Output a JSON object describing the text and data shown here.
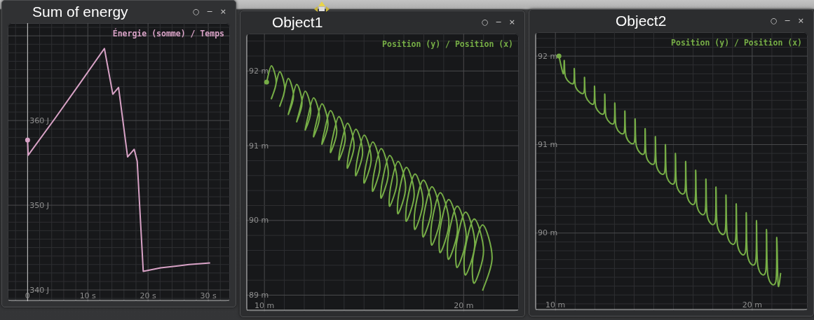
{
  "windows": [
    {
      "title": "Sum of energy",
      "controls": [
        "○",
        "−",
        "×"
      ],
      "chart_data": {
        "type": "line",
        "title": "Énergie (somme) / Temps",
        "grid": true,
        "xlim": [
          -3.3,
          33.6
        ],
        "ylim": [
          338.6,
          371.5
        ],
        "xticks": [
          {
            "value": 0,
            "label": "0"
          },
          {
            "value": 10,
            "label": "10 s"
          },
          {
            "value": 20,
            "label": "20 s"
          },
          {
            "value": 30,
            "label": "30 s"
          }
        ],
        "yticks": [
          {
            "value": 340,
            "label": "340 J"
          },
          {
            "value": 350,
            "label": "350 J"
          },
          {
            "value": 360,
            "label": "360 J"
          }
        ],
        "x": [
          0,
          0.1,
          4.6,
          8.7,
          12.75,
          14.15,
          15.1,
          16.6,
          17.7,
          18.2,
          19.2,
          22.1,
          26.8,
          30.3
        ],
        "series": [
          {
            "color": "#d8a2c6",
            "values": [
              357.7,
              355.9,
              360.3,
              364.4,
              368.5,
              363.1,
              363.9,
              355.7,
              356.6,
              355.2,
              342.2,
              342.6,
              343.0,
              343.2
            ]
          }
        ]
      }
    },
    {
      "title": "Object1",
      "controls": [
        "○",
        "−",
        "×"
      ],
      "chart_data": {
        "type": "line",
        "title": "Position (y) / Position (x)",
        "grid": true,
        "xlim": [
          9.08,
          22.77
        ],
        "ylim": [
          88.78,
          92.5
        ],
        "xticks": [
          {
            "value": 10,
            "label": "10 m"
          },
          {
            "value": 20,
            "label": "20 m"
          }
        ],
        "yticks": [
          {
            "value": 89,
            "label": "89 m"
          },
          {
            "value": 90,
            "label": "90 m"
          },
          {
            "value": 91,
            "label": "91 m"
          },
          {
            "value": 92,
            "label": "92 m"
          }
        ],
        "x": [
          10.11,
          10.35,
          10.59,
          10.35,
          10.52,
          10.77,
          11.02,
          10.77,
          10.94,
          11.2,
          11.46,
          11.2,
          11.35,
          11.62,
          11.89,
          11.62,
          11.77,
          12.05,
          12.33,
          12.05,
          12.18,
          12.47,
          12.76,
          12.47,
          12.59,
          12.89,
          13.19,
          12.89,
          13.01,
          13.32,
          13.63,
          13.32,
          13.42,
          13.74,
          14.06,
          13.74,
          13.84,
          14.17,
          14.5,
          14.17,
          14.25,
          14.59,
          14.93,
          14.59,
          14.66,
          15.01,
          15.36,
          15.01,
          15.08,
          15.44,
          15.8,
          15.44,
          15.5,
          15.86,
          16.22,
          15.86,
          15.92,
          16.29,
          16.66,
          16.29,
          16.33,
          16.71,
          17.09,
          16.71,
          16.74,
          17.13,
          17.52,
          17.13,
          17.16,
          17.56,
          17.96,
          17.56,
          17.57,
          17.98,
          18.39,
          17.98,
          17.99,
          18.41,
          18.83,
          18.41,
          18.4,
          18.83,
          19.26,
          18.83,
          18.81,
          19.25,
          19.69,
          19.25,
          19.23,
          19.68,
          20.13,
          19.68,
          19.64,
          20.1,
          20.56,
          20.1,
          20.06,
          20.53,
          21.0,
          20.53,
          20.47,
          20.95,
          21.43,
          20.95
        ],
        "series": [
          {
            "color": "#76ad46",
            "values": [
              91.85,
              92.07,
              91.85,
              91.63,
              91.76,
              91.99,
              91.76,
              91.53,
              91.66,
              91.9,
              91.66,
              91.42,
              91.57,
              91.82,
              91.57,
              91.32,
              91.47,
              91.73,
              91.47,
              91.21,
              91.38,
              91.64,
              91.38,
              91.12,
              91.29,
              91.56,
              91.29,
              91.02,
              91.19,
              91.47,
              91.19,
              90.91,
              91.1,
              91.39,
              91.1,
              90.81,
              91.0,
              91.3,
              91.0,
              90.7,
              90.91,
              91.22,
              90.91,
              90.6,
              90.82,
              91.14,
              90.82,
              90.5,
              90.72,
              91.05,
              90.72,
              90.39,
              90.63,
              90.96,
              90.63,
              90.3,
              90.53,
              90.87,
              90.53,
              90.19,
              90.44,
              90.79,
              90.44,
              90.09,
              90.35,
              90.71,
              90.35,
              89.99,
              90.25,
              90.62,
              90.25,
              89.88,
              90.16,
              90.54,
              90.16,
              89.78,
              90.06,
              90.45,
              90.06,
              89.67,
              89.97,
              90.37,
              89.97,
              89.57,
              89.88,
              90.28,
              89.88,
              89.48,
              89.78,
              90.19,
              89.78,
              89.37,
              89.69,
              90.11,
              89.69,
              89.27,
              89.59,
              90.02,
              89.59,
              89.16,
              89.5,
              89.94,
              89.5,
              89.06
            ]
          }
        ]
      }
    },
    {
      "title": "Object2",
      "controls": [
        "○",
        "−",
        "×"
      ],
      "chart_data": {
        "type": "line",
        "title": "Position (y) / Position (x)",
        "grid": true,
        "xlim": [
          8.96,
          22.82
        ],
        "ylim": [
          89.12,
          92.27
        ],
        "xticks": [
          {
            "value": 10,
            "label": "10 m"
          },
          {
            "value": 20,
            "label": "20 m"
          }
        ],
        "yticks": [
          {
            "value": 90,
            "label": "90 m"
          },
          {
            "value": 91,
            "label": "91 m"
          },
          {
            "value": 92,
            "label": "92 m"
          }
        ],
        "x": [
          10.18,
          10.4,
          10.45,
          10.52,
          10.91,
          10.96,
          11.03,
          11.43,
          11.48,
          11.55,
          11.94,
          11.99,
          12.06,
          12.46,
          12.51,
          12.58,
          12.97,
          13.02,
          13.09,
          13.48,
          13.53,
          13.6,
          14.0,
          14.05,
          14.12,
          14.51,
          14.56,
          14.63,
          15.03,
          15.08,
          15.15,
          15.54,
          15.59,
          15.66,
          16.05,
          16.1,
          16.17,
          16.57,
          16.62,
          16.69,
          17.08,
          17.13,
          17.2,
          17.6,
          17.65,
          17.72,
          18.11,
          18.16,
          18.23,
          18.62,
          18.67,
          18.74,
          19.14,
          19.19,
          19.26,
          19.65,
          19.7,
          19.77,
          20.17,
          20.22,
          20.29,
          20.68,
          20.73,
          20.8,
          21.2,
          21.25,
          21.32,
          21.45
        ],
        "series": [
          {
            "color": "#76ad46",
            "values": [
              92.0,
              91.8,
              91.95,
              91.76,
              91.69,
              91.86,
              91.65,
              91.58,
              91.76,
              91.54,
              91.46,
              91.66,
              91.42,
              91.35,
              91.57,
              91.31,
              91.24,
              91.47,
              91.2,
              91.13,
              91.38,
              91.09,
              91.02,
              91.29,
              90.98,
              90.9,
              91.18,
              90.86,
              90.79,
              91.09,
              90.75,
              90.68,
              91.0,
              90.64,
              90.57,
              90.9,
              90.53,
              90.46,
              90.81,
              90.42,
              90.34,
              90.71,
              90.3,
              90.23,
              90.61,
              90.19,
              90.12,
              90.52,
              90.08,
              90.01,
              90.43,
              89.97,
              89.9,
              90.33,
              89.86,
              89.78,
              90.23,
              89.74,
              89.67,
              90.14,
              89.63,
              89.56,
              90.04,
              89.52,
              89.45,
              89.95,
              89.41,
              89.55
            ]
          }
        ]
      }
    }
  ]
}
